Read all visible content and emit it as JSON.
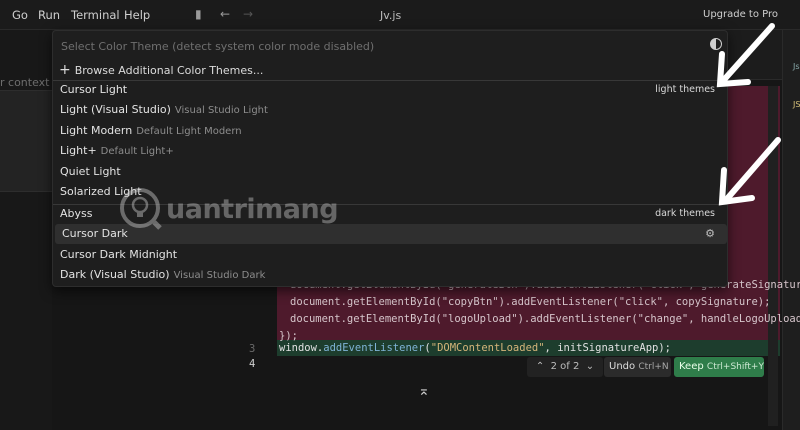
{
  "menubar": {
    "items": [
      "Go",
      "Run",
      "Terminal",
      "Help"
    ],
    "title": "Jv.js",
    "upgrade": "Upgrade to Pro"
  },
  "left_pane": {
    "context_text": "r context"
  },
  "quick_pick": {
    "placeholder": "Select Color Theme (detect system color mode disabled)",
    "browse_label": "Browse Additional Color Themes...",
    "groups": [
      {
        "label": "light themes",
        "items": [
          {
            "name": "Cursor Light",
            "desc": ""
          },
          {
            "name": "Light (Visual Studio)",
            "desc": "Visual Studio Light"
          },
          {
            "name": "Light Modern",
            "desc": "Default Light Modern"
          },
          {
            "name": "Light+",
            "desc": "Default Light+"
          },
          {
            "name": "Quiet Light",
            "desc": ""
          },
          {
            "name": "Solarized Light",
            "desc": ""
          }
        ]
      },
      {
        "label": "dark themes",
        "items": [
          {
            "name": "Abyss",
            "desc": ""
          },
          {
            "name": "Cursor Dark",
            "desc": ""
          },
          {
            "name": "Cursor Dark Midnight",
            "desc": ""
          },
          {
            "name": "Dark (Visual Studio)",
            "desc": "Visual Studio Dark"
          }
        ]
      }
    ],
    "selected": "Cursor Dark"
  },
  "editor": {
    "deleted_lines": [
      "document.getElementById(\"generateBtn\").addEventListener(\"click\", generateSignature);",
      "document.getElementById(\"copyBtn\").addEventListener(\"click\", copySignature);",
      "document.getElementById(\"logoUpload\").addEventListener(\"change\", handleLogoUpload);",
      "});"
    ],
    "line_numbers": [
      "3",
      "4"
    ],
    "added_line": {
      "obj": "window.",
      "fn": "addEventListener",
      "open": "(",
      "str": "\"DOMContentLoaded\"",
      "rest": ", initSignatureApp);"
    }
  },
  "diff_bar": {
    "counter": "2 of 2",
    "undo_label": "Undo",
    "undo_shortcut": "Ctrl+N",
    "keep_label": "Keep",
    "keep_shortcut": "Ctrl+Shift+Y"
  },
  "watermark": {
    "text": "uantrimang"
  },
  "right_strip": {
    "labels": [
      "Js",
      "JS"
    ]
  },
  "colors": {
    "deleted_bg": "#4e1a2c",
    "added_bg": "#1d3d2d",
    "keep_button": "#2f7d4a",
    "selected_row": "#2f2f2f"
  }
}
